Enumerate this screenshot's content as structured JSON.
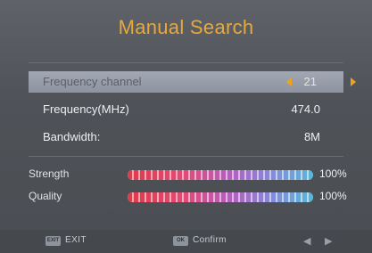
{
  "header": {
    "title": "Manual Search"
  },
  "settings": {
    "frequency_channel": {
      "label": "Frequency channel",
      "value": "21"
    },
    "frequency": {
      "label": "Frequency(MHz)",
      "value": "474.0"
    },
    "bandwidth": {
      "label": "Bandwidth:",
      "value": "8M"
    }
  },
  "signal": {
    "strength": {
      "label": "Strength",
      "percent_text": "100%",
      "level": 100
    },
    "quality": {
      "label": "Quality",
      "percent_text": "100%",
      "level": 100
    }
  },
  "footer": {
    "exit_key": "EXIT",
    "exit_label": "EXIT",
    "ok_key": "OK",
    "confirm_label": "Confirm",
    "nav_left": "◀",
    "nav_right": "▶"
  },
  "colors": {
    "title": "#e8a83a",
    "arrows": "#f0a21a",
    "selected_row": "#9aa0ab",
    "bar_start": "#e03a4a",
    "bar_end": "#58b8d8"
  },
  "icons": [
    "left-arrow-icon",
    "right-arrow-icon",
    "exit-key-icon",
    "ok-key-icon"
  ]
}
